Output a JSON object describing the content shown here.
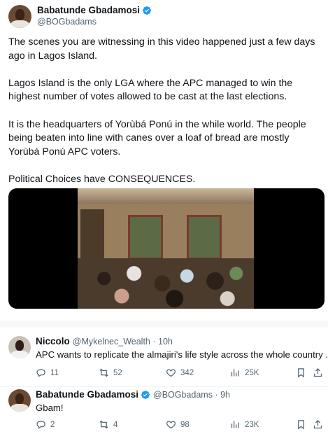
{
  "main_tweet": {
    "author_name": "Babatunde Gbadamosi",
    "author_handle": "@BOGbadams",
    "paragraphs": [
      "The scenes you are witnessing in this video happened just a few days ago in Lagos Island.",
      "Lagos Island is the only LGA where the APC managed to win the highest number of votes allowed to be cast at the last elections.",
      "It is the headquarters of Yorùbá Ponú in the while world. The people being beaten into line with canes over a loaf of bread are mostly Yorùbá Ponú APC voters.",
      "Political Choices have CONSEQUENCES."
    ]
  },
  "replies": [
    {
      "author_name": "Niccolo",
      "meta": "@Mykelnec_Wealth · 10h",
      "text": "APC wants to replicate the almajiri's life style across the whole country .",
      "verified": false,
      "actions": {
        "replies": "11",
        "reposts": "52",
        "likes": "342",
        "views": "25K"
      }
    },
    {
      "author_name": "Babatunde Gbadamosi",
      "meta": "@BOGbadams · 9h",
      "text": "Gbam!",
      "verified": true,
      "actions": {
        "replies": "2",
        "reposts": "4",
        "likes": "98",
        "views": "23K"
      }
    }
  ],
  "colors": {
    "verified_blue": "#1d9bf0",
    "text_primary": "#0f1419",
    "text_secondary": "#536471",
    "divider": "#eff3f4"
  },
  "icons": [
    "verified-badge-icon",
    "reply-icon",
    "repost-icon",
    "like-icon",
    "views-icon",
    "bookmark-icon",
    "share-icon"
  ]
}
